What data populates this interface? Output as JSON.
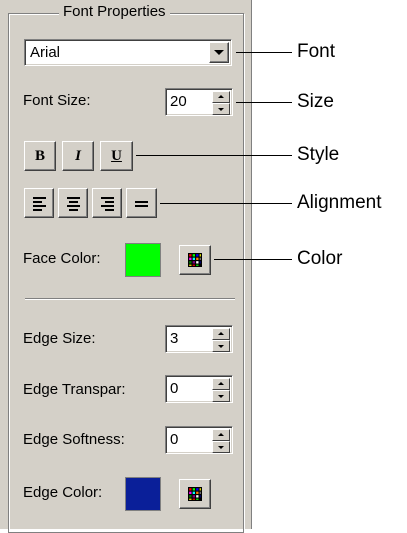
{
  "group": {
    "title": "Font Properties"
  },
  "font": {
    "value": "Arial"
  },
  "font_size": {
    "label": "Font Size:",
    "value": "20"
  },
  "style": {
    "bold": "B",
    "italic": "I",
    "underline": "U"
  },
  "face_color": {
    "label": "Face Color:",
    "color": "#00ff00"
  },
  "edge_size": {
    "label": "Edge Size:",
    "value": "3"
  },
  "edge_transparency": {
    "label": "Edge Transpar:",
    "value": "0"
  },
  "edge_softness": {
    "label": "Edge Softness:",
    "value": "0"
  },
  "edge_color": {
    "label": "Edge Color:",
    "color": "#0a1f99"
  },
  "callouts": {
    "font": "Font",
    "size": "Size",
    "style": "Style",
    "alignment": "Alignment",
    "color": "Color"
  }
}
